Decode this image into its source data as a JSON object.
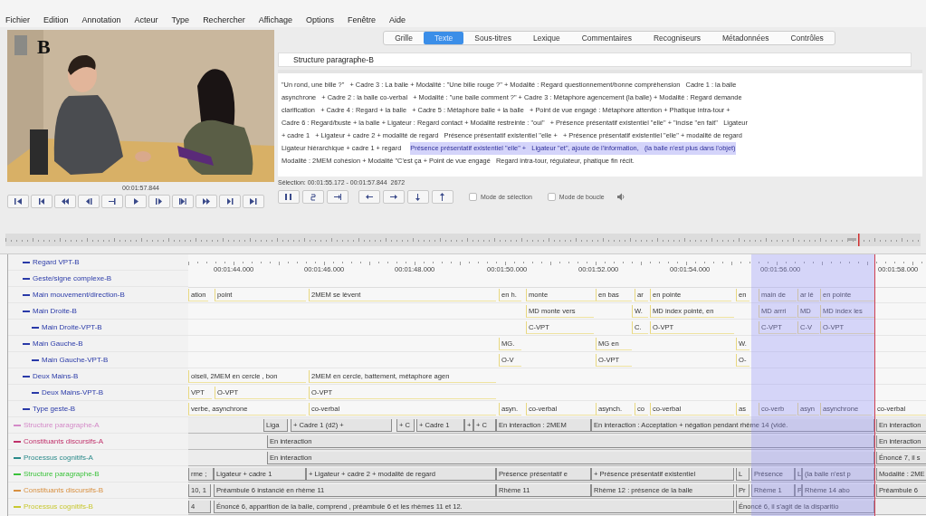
{
  "menu": [
    "Fichier",
    "Edition",
    "Annotation",
    "Acteur",
    "Type",
    "Rechercher",
    "Affichage",
    "Options",
    "Fenêtre",
    "Aide"
  ],
  "video": {
    "figure_label": "B",
    "timecode": "00:01:57.844"
  },
  "tabs": [
    {
      "label": "Grille",
      "selected": false
    },
    {
      "label": "Texte",
      "selected": true
    },
    {
      "label": "Sous-titres",
      "selected": false
    },
    {
      "label": "Lexique",
      "selected": false
    },
    {
      "label": "Commentaires",
      "selected": false
    },
    {
      "label": "Recogniseurs",
      "selected": false
    },
    {
      "label": "Métadonnées",
      "selected": false
    },
    {
      "label": "Contrôles",
      "selected": false
    }
  ],
  "text_viewer": {
    "tier": "Structure paragraphe-B",
    "lines": [
      [
        {
          "text": "\"Un rond, une bille ?\"   + Cadre 3 : La balle + Modalité : \"Une bille rouge ?\" + Modalité : Regard questionnement/bonne compréhension   Cadre 1 : la balle",
          "selected": false
        }
      ],
      [
        {
          "text": "asynchrone   + Cadre 2 : la balle co-verbal   + Modalité : \"une balle comment ?\" + Cadre 3 : Métaphore agencement (la balle) + Modalité : Regard demande",
          "selected": false
        }
      ],
      [
        {
          "text": "clarification   + Cadre 4 : Regard + la balle   + Cadre 5 : Métaphore balle + la balle   + Point de vue engagé : Métaphore attention + Phatique intra-tour +",
          "selected": false
        }
      ],
      [
        {
          "text": "Cadre 6 : Regard/buste + la balle + Ligateur : Regard contact + Modalité restreinte : \"oui\"   + Présence présentatif existentiel \"elle\" + \"incise \"en fait\"   Ligateur",
          "selected": false
        }
      ],
      [
        {
          "text": "+ cadre 1   + Ligateur + cadre 2 + modalité de regard   Présence présentatif existentiel \"elle +   + Présence présentatif existentiel \"elle\" + modalité de regard",
          "selected": false
        }
      ],
      [
        {
          "text": "Ligateur hiérarchique + cadre 1 + regard",
          "selected": false
        },
        {
          "text": "Présence présentatif existentiel \"elle\" +   Ligateur \"et\", ajoute de l'information,   (la balle n'est plus dans l'objet)",
          "selected": true
        }
      ],
      [
        {
          "text": "Modalité : 2MEM cohésion + Modalité \"C'est ça + Point de vue engagé   Regard intra-tour, régulateur, phatique fin récit.",
          "selected": false
        }
      ]
    ]
  },
  "selection": "Sélection: 00:01:55.172 - 00:01:57.844  2672",
  "modes": [
    {
      "label": "Mode de sélection",
      "checked": false
    },
    {
      "label": "Mode de boucle",
      "checked": false
    }
  ],
  "ruler": [
    "00:01:44.000",
    "00:01:46.000",
    "00:01:48.000",
    "00:01:50.000",
    "00:01:52.000",
    "00:01:54.000",
    "00:01:56.000",
    "00:01:58.000"
  ],
  "tiers": [
    {
      "name": "Regard VPT-B",
      "color": "#2a3aa8",
      "kind": "gesture"
    },
    {
      "name": "Geste/signe complexe-B",
      "color": "#2a3aa8",
      "kind": "gesture"
    },
    {
      "name": "Main mouvement/direction-B",
      "color": "#2a3aa8",
      "kind": "gesture",
      "annotations": [
        "ation",
        "point",
        "2MEM se lèvent",
        "en h.",
        "monte",
        "en bas",
        "ar",
        "en pointe",
        "en",
        "main de",
        "ar lé",
        "en pointe"
      ]
    },
    {
      "name": "Main Droite-B",
      "color": "#2a3aa8",
      "kind": "gesture",
      "annotations": [
        "MD monte vers",
        "W.",
        "MD index pointé, en",
        "MD arrri",
        "MD",
        "MD index les"
      ],
      "children": [
        {
          "name": "Main Droite-VPT-B",
          "color": "#2a3aa8",
          "kind": "gesture",
          "annotations": [
            "C-VPT",
            "C.",
            "O-VPT",
            "C-VPT",
            "C-V",
            "O-VPT"
          ]
        }
      ]
    },
    {
      "name": "Main Gauche-B",
      "color": "#2a3aa8",
      "kind": "gesture",
      "annotations": [
        "MG.",
        "MG en",
        "W."
      ],
      "children": [
        {
          "name": "Main Gauche-VPT-B",
          "color": "#2a3aa8",
          "kind": "gesture",
          "annotations": [
            "O-V",
            "O-VPT",
            "O-"
          ]
        }
      ]
    },
    {
      "name": "Deux Mains-B",
      "color": "#2a3aa8",
      "kind": "gesture",
      "annotations": [
        "oiseli, 2MEM en cercle , bon",
        "2MEM en cercle, battement, métaphore agen"
      ],
      "children": [
        {
          "name": "Deux Mains-VPT-B",
          "color": "#2a3aa8",
          "kind": "gesture",
          "annotations": [
            "VPT",
            "O-VPT",
            "O-VPT"
          ]
        }
      ]
    },
    {
      "name": "Type geste-B",
      "color": "#2a3aa8",
      "kind": "gesture",
      "annotations": [
        "verbe, asynchrone",
        "co-verbal",
        "asyn.",
        "co-verbal",
        "asynch.",
        "co",
        "co-verbal",
        "as",
        "co-verb",
        "asyn",
        "asynchrone",
        "co-verbal"
      ]
    },
    {
      "name": "Structure paragraphe-A",
      "color": "#d48ac8",
      "kind": "discourse",
      "annotations": [
        "Liga",
        "+ Cadre 1 (d2) +",
        "+ C",
        "+ Cadre 1",
        "+",
        "+ C",
        "En interaction : 2MEM",
        "En interaction : Acceptation + négation pendant rhème 14 (vidé.",
        "En interaction"
      ]
    },
    {
      "name": "Constituants discursifs-A",
      "color": "#c0306a",
      "kind": "discourse",
      "annotations": [
        "En interaction",
        "En interaction"
      ]
    },
    {
      "name": "Processus cognitifs-A",
      "color": "#2a8a8a",
      "kind": "discourse",
      "annotations": [
        "En interaction",
        "Énoncé 7, il s"
      ]
    },
    {
      "name": "Structure paragraphe-B",
      "color": "#3ac23a",
      "kind": "discourse",
      "annotations": [
        "rme ;",
        "Ligateur + cadre 1",
        "+ Ligateur + cadre 2 + modalité de regard",
        "Présence présentatif e",
        "+ Présence présentatif existentiel",
        "L",
        "Présence",
        "L",
        "(la balle n'est p",
        "Modalité : 2ME"
      ]
    },
    {
      "name": "Constituants discursifs-B",
      "color": "#d89040",
      "kind": "discourse",
      "annotations": [
        "10, 1",
        "Préambule 6 instancié en rhème 11",
        "Rhème 11",
        "Rhème 12 : présence de la balle",
        "Pr",
        "Rhème 1",
        "P",
        "Rhème 14 abo",
        "Préambule 6"
      ]
    },
    {
      "name": "Processus cognitifs-B",
      "color": "#c8c830",
      "kind": "discourse",
      "annotations": [
        "4",
        "Énoncé 6, apparition de la balle, comprend , préambule 6 et les rhèmes 11 et 12.",
        "Énoncé 6, il s'agit de la disparitio"
      ]
    }
  ]
}
